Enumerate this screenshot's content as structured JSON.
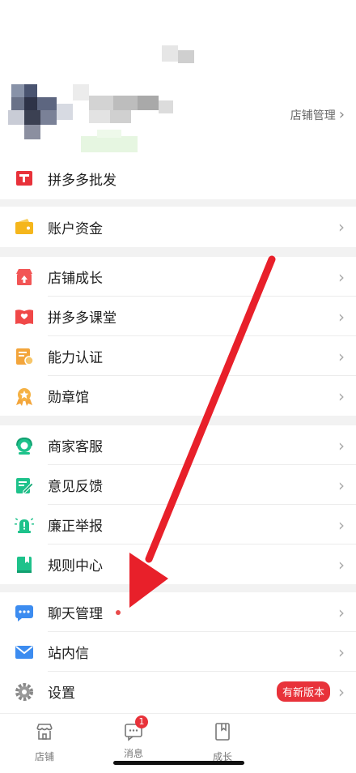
{
  "header": {
    "store_manage_label": "店铺管理",
    "chevron": "›"
  },
  "menu": {
    "wholesale": {
      "label": "拼多多批发",
      "icon": "wholesale-icon"
    },
    "funds": {
      "label": "账户资金",
      "icon": "wallet-icon"
    },
    "growth_group": [
      {
        "label": "店铺成长",
        "icon": "store-growth-icon"
      },
      {
        "label": "拼多多课堂",
        "icon": "classroom-icon"
      },
      {
        "label": "能力认证",
        "icon": "certification-icon"
      },
      {
        "label": "勋章馆",
        "icon": "medal-icon"
      }
    ],
    "service_group": [
      {
        "label": "商家客服",
        "icon": "customer-service-icon"
      },
      {
        "label": "意见反馈",
        "icon": "feedback-icon"
      },
      {
        "label": "廉正举报",
        "icon": "report-icon"
      },
      {
        "label": "规则中心",
        "icon": "rules-icon"
      }
    ],
    "settings_group": [
      {
        "label": "聊天管理",
        "icon": "chat-manage-icon"
      },
      {
        "label": "站内信",
        "icon": "mail-icon"
      },
      {
        "label": "设置",
        "icon": "gear-icon",
        "badge": "有新版本"
      }
    ]
  },
  "tabbar": {
    "tabs": [
      {
        "label": "店铺",
        "icon": "store-icon"
      },
      {
        "label": "消息",
        "icon": "message-icon",
        "badge": "1"
      },
      {
        "label": "成长",
        "icon": "growth-icon"
      }
    ]
  },
  "colors": {
    "accent_red": "#e8323a",
    "arrow_red": "#e8202a",
    "green": "#1ec28b"
  }
}
